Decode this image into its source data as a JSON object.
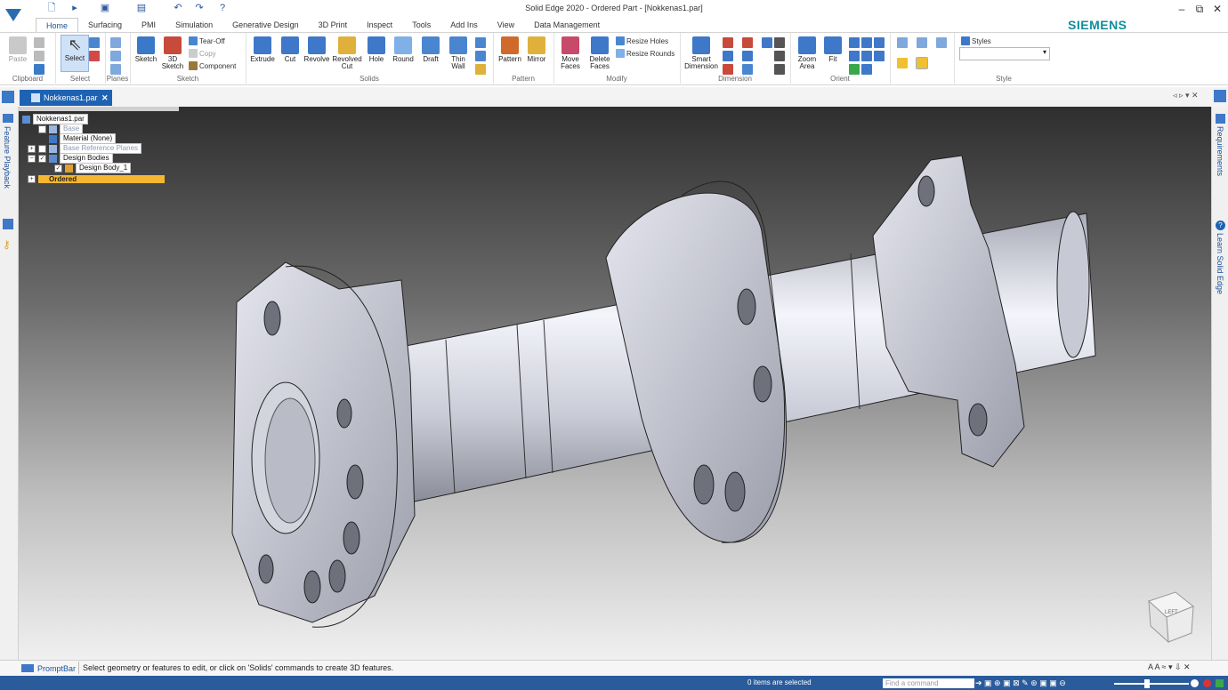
{
  "window": {
    "title": "Solid Edge 2020 - Ordered Part - [Nokkenas1.par]",
    "brand": "SIEMENS",
    "controls": {
      "minimize": "–",
      "restore": "⧉",
      "close": "✕"
    }
  },
  "ribbon": {
    "tabs": [
      "Home",
      "Surfacing",
      "PMI",
      "Simulation",
      "Generative Design",
      "3D Print",
      "Inspect",
      "Tools",
      "Add Ins",
      "View",
      "Data Management"
    ],
    "active_tab": "Home",
    "groups": {
      "clipboard": {
        "label": "Clipboard",
        "paste": "Paste"
      },
      "select": {
        "label": "Select",
        "select": "Select"
      },
      "planes": {
        "label": "Planes"
      },
      "sketch": {
        "label": "Sketch",
        "sketch": "Sketch",
        "sketch3d": "3D Sketch",
        "tear_off": "Tear-Off",
        "copy": "Copy",
        "component": "Component"
      },
      "solids": {
        "label": "Solids",
        "extrude": "Extrude",
        "cut": "Cut",
        "revolve": "Revolve",
        "revolved_cut": "Revolved Cut",
        "hole": "Hole",
        "round": "Round",
        "draft": "Draft",
        "thin_wall": "Thin Wall"
      },
      "pattern": {
        "label": "Pattern",
        "pattern": "Pattern",
        "mirror": "Mirror"
      },
      "modify": {
        "label": "Modify",
        "move_faces": "Move Faces",
        "delete_faces": "Delete Faces",
        "resize_holes": "Resize Holes",
        "resize_rounds": "Resize Rounds"
      },
      "dimension": {
        "label": "Dimension",
        "smart_dimension": "Smart Dimension"
      },
      "orient": {
        "label": "Orient",
        "zoom_area": "Zoom Area",
        "fit": "Fit"
      },
      "style": {
        "label": "Style",
        "styles": "Styles",
        "styles_value": ""
      }
    }
  },
  "document": {
    "tab_label": "Nokkenas1.par",
    "tab_close": "✕"
  },
  "left_panel": {
    "feature_playback": "Feature Playback"
  },
  "right_panel": {
    "requirements": "Requirements",
    "learn": "Learn Solid Edge"
  },
  "tree": {
    "root": "Nokkenas1.par",
    "items": [
      {
        "label": "Base",
        "checked": false
      },
      {
        "label": "Material (None)"
      },
      {
        "label": "Base Reference Planes",
        "checked": false
      },
      {
        "label": "Design Bodies",
        "checked": true
      },
      {
        "label": "Design Body_1",
        "checked": true
      },
      {
        "label": "Ordered"
      }
    ]
  },
  "viewcube": {
    "face_label": "LEFT"
  },
  "promptbar": {
    "label": "PromptBar",
    "message": "Select geometry or features to edit, or click on 'Solids' commands to create 3D features."
  },
  "statusbar": {
    "selection": "0 items are selected",
    "find_placeholder": "Find a command"
  },
  "colors": {
    "accent": "#1e63b3",
    "brand": "#0f8e9c",
    "status": "#2a5b9b",
    "ordered": "#f5b731"
  }
}
